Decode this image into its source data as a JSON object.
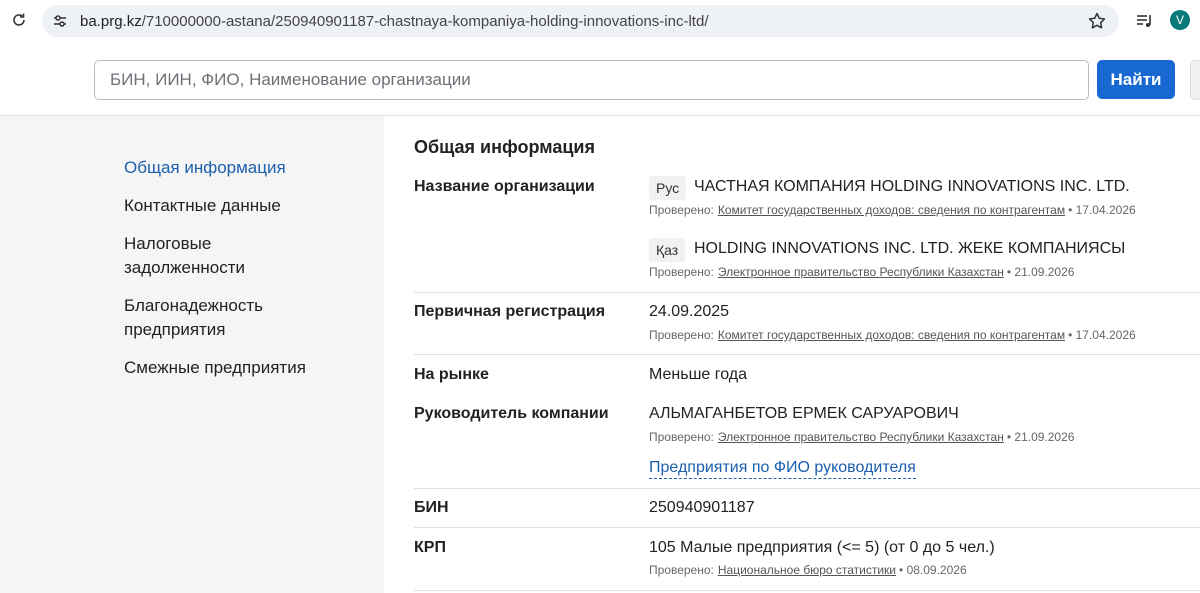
{
  "browser": {
    "url_host": "ba.prg.kz",
    "url_path": "/710000000-astana/250940901187-chastnaya-kompaniya-holding-innovations-inc-ltd/",
    "avatar_letter": "V"
  },
  "search": {
    "placeholder": "БИН, ИИН, ФИО, Наименование организации",
    "button_label": "Найти"
  },
  "sidebar": {
    "items": [
      {
        "label": "Общая информация",
        "active": true
      },
      {
        "label": "Контактные данные"
      },
      {
        "label": "Налоговые задолженности"
      },
      {
        "label": "Благонадежность предприятия"
      },
      {
        "label": "Смежные предприятия"
      }
    ]
  },
  "main": {
    "title": "Общая информация",
    "verified_prefix": "Проверено:",
    "org_name": {
      "label": "Название организации",
      "ru_tag": "Рус",
      "ru_value": "ЧАСТНАЯ КОМПАНИЯ HOLDING INNOVATIONS INC. LTD.",
      "ru_source": "Комитет государственных доходов: сведения по контрагентам",
      "ru_date": "17.04.2026",
      "kz_tag": "Қаз",
      "kz_value": "HOLDING INNOVATIONS INC. LTD. ЖЕКЕ КОМПАНИЯСЫ",
      "kz_source": "Электронное правительство Республики Казахстан",
      "kz_date": "21.09.2026"
    },
    "registration": {
      "label": "Первичная регистрация",
      "value": "24.09.2025",
      "source": "Комитет государственных доходов: сведения по контрагентам",
      "date": "17.04.2026"
    },
    "market": {
      "label": "На рынке",
      "value": "Меньше года"
    },
    "director": {
      "label": "Руководитель компании",
      "value": "АЛЬМАГАНБЕТОВ ЕРМЕК САРУАРОВИЧ",
      "source": "Электронное правительство Республики Казахстан",
      "date": "21.09.2026",
      "link": "Предприятия по ФИО руководителя"
    },
    "bin": {
      "label": "БИН",
      "value": "250940901187"
    },
    "krp": {
      "label": "КРП",
      "value": "105 Малые предприятия (<= 5) (от 0 до 5 чел.)",
      "source": "Национальное бюро статистики",
      "date": "08.09.2026"
    }
  }
}
